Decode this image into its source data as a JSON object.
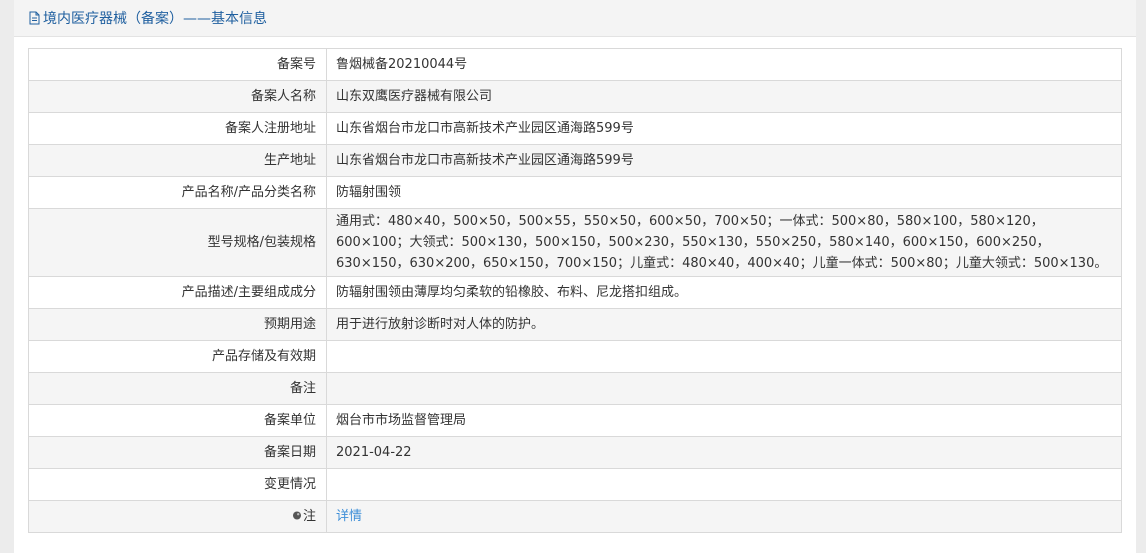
{
  "header": {
    "title": "境内医疗器械（备案）——基本信息",
    "icon": "document-icon"
  },
  "rows": [
    {
      "label": "备案号",
      "value": "鲁烟械备20210044号"
    },
    {
      "label": "备案人名称",
      "value": "山东双鹰医疗器械有限公司"
    },
    {
      "label": "备案人注册地址",
      "value": "山东省烟台市龙口市高新技术产业园区通海路599号"
    },
    {
      "label": "生产地址",
      "value": "山东省烟台市龙口市高新技术产业园区通海路599号"
    },
    {
      "label": "产品名称/产品分类名称",
      "value": "防辐射围领"
    },
    {
      "label": "型号规格/包装规格",
      "value": "通用式：480×40，500×50，500×55，550×50，600×50，700×50；一体式：500×80，580×100，580×120，600×100；大领式：500×130，500×150，500×230，550×130，550×250，580×140，600×150，600×250，630×150，630×200，650×150，700×150；儿童式：480×40，400×40；儿童一体式：500×80；儿童大领式：500×130。"
    },
    {
      "label": "产品描述/主要组成成分",
      "value": "防辐射围领由薄厚均匀柔软的铅橡胶、布料、尼龙搭扣组成。"
    },
    {
      "label": "预期用途",
      "value": "用于进行放射诊断时对人体的防护。"
    },
    {
      "label": "产品存储及有效期",
      "value": ""
    },
    {
      "label": "备注",
      "value": ""
    },
    {
      "label": "备案单位",
      "value": "烟台市市场监督管理局"
    },
    {
      "label": "备案日期",
      "value": "2021-04-22"
    },
    {
      "label": "变更情况",
      "value": ""
    },
    {
      "label": "注",
      "value": "详情",
      "icon": "pin-icon"
    }
  ]
}
